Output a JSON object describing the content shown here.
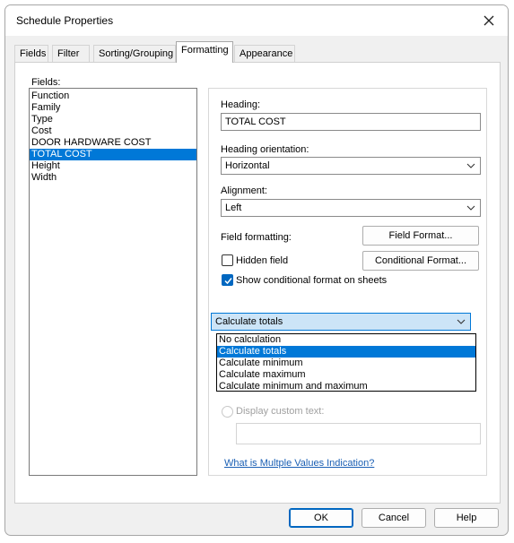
{
  "window": {
    "title": "Schedule Properties"
  },
  "tabs": [
    {
      "label": "Fields"
    },
    {
      "label": "Filter"
    },
    {
      "label": "Sorting/Grouping"
    },
    {
      "label": "Formatting"
    },
    {
      "label": "Appearance"
    }
  ],
  "fields_panel": {
    "label": "Fields:",
    "items": [
      "Function",
      "Family",
      "Type",
      "Cost",
      "DOOR HARDWARE COST",
      "TOTAL COST",
      "Height",
      "Width"
    ],
    "selected": "TOTAL COST"
  },
  "formatting": {
    "heading_label": "Heading:",
    "heading_value": "TOTAL COST",
    "orientation_label": "Heading orientation:",
    "orientation_value": "Horizontal",
    "alignment_label": "Alignment:",
    "alignment_value": "Left",
    "field_formatting_label": "Field formatting:",
    "field_format_button": "Field Format...",
    "hidden_field_label": "Hidden field",
    "hidden_field_checked": false,
    "conditional_format_button": "Conditional  Format...",
    "show_conditional_label": "Show conditional format on sheets",
    "show_conditional_checked": true,
    "totals_value": "Calculate totals",
    "totals_options": [
      "No calculation",
      "Calculate totals",
      "Calculate minimum",
      "Calculate maximum",
      "Calculate minimum and maximum"
    ],
    "totals_selected": "Calculate totals",
    "custom_text_label": "Display custom text:",
    "custom_text_value": "",
    "multiple_values_link": "What is Multple Values Indication?"
  },
  "footer": {
    "ok": "OK",
    "cancel": "Cancel",
    "help": "Help"
  },
  "colors": {
    "accent": "#0078d7",
    "checkbox_accent": "#0067c0",
    "link": "#1a5fb4"
  }
}
